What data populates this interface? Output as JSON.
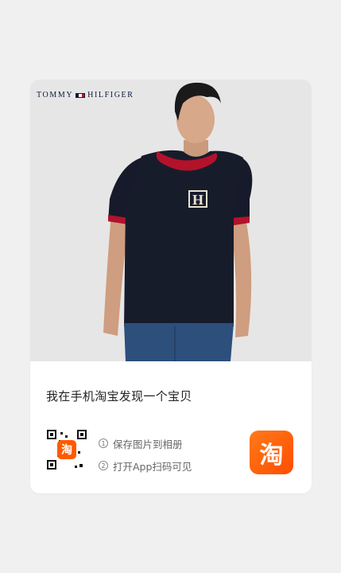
{
  "brand": {
    "name_left": "TOMMY",
    "name_right": "HILFIGER",
    "flag_colors": [
      "#0b1b3a",
      "#ffffff",
      "#c8102e"
    ]
  },
  "product_image": {
    "alt": "Man wearing navy T-shirt with red collar and H logo",
    "shirt_color": "#171c2b",
    "accent_color": "#b3122b"
  },
  "card": {
    "title": "我在手机淘宝发现一个宝贝",
    "steps": [
      {
        "num": "1",
        "text": "保存图片到相册"
      },
      {
        "num": "2",
        "text": "打开App扫码可见"
      }
    ],
    "qr_center_glyph": "淘",
    "app_logo_glyph": "淘",
    "logo_color": "#ff5a00"
  }
}
